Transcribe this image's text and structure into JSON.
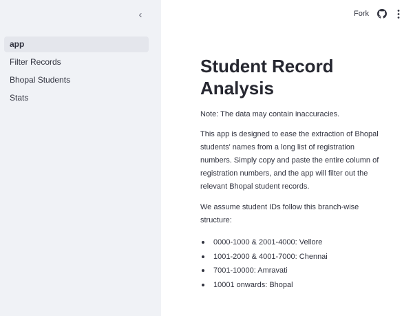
{
  "sidebar": {
    "collapse_glyph": "‹",
    "items": [
      {
        "label": "app",
        "active": true
      },
      {
        "label": "Filter Records",
        "active": false
      },
      {
        "label": "Bhopal Students",
        "active": false
      },
      {
        "label": "Stats",
        "active": false
      }
    ]
  },
  "toolbar": {
    "fork_label": "Fork",
    "github_icon": "github-icon",
    "menu_icon": "kebab-menu-icon"
  },
  "main": {
    "title": "Student Record Analysis",
    "note": "Note: The data may contain inaccuracies.",
    "description": "This app is designed to ease the extraction of Bhopal students' names from a long list of registration numbers. Simply copy and paste the entire column of registration numbers, and the app will filter out the relevant Bhopal student records.",
    "structure_intro": "We assume student IDs follow this branch-wise structure:",
    "branches": [
      "0000-1000 & 2001-4000: Vellore",
      "1001-2000 & 4001-7000: Chennai",
      "7001-10000: Amravati",
      "10001 onwards: Bhopal"
    ]
  },
  "colors": {
    "sidebar_bg": "#f0f2f6",
    "active_item_bg": "#e4e6ec",
    "text": "#31333f"
  }
}
